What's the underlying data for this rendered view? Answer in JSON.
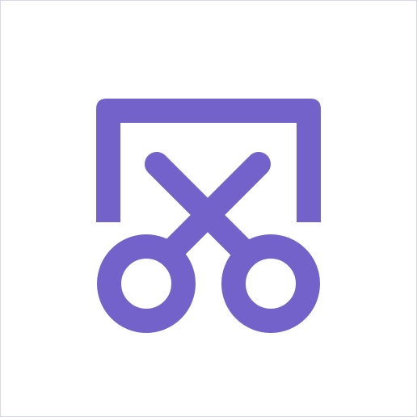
{
  "icon": {
    "name": "screen-snip-icon",
    "color": "#7262c9",
    "background": "#ffffff",
    "border_color": "#d6d6f0"
  }
}
